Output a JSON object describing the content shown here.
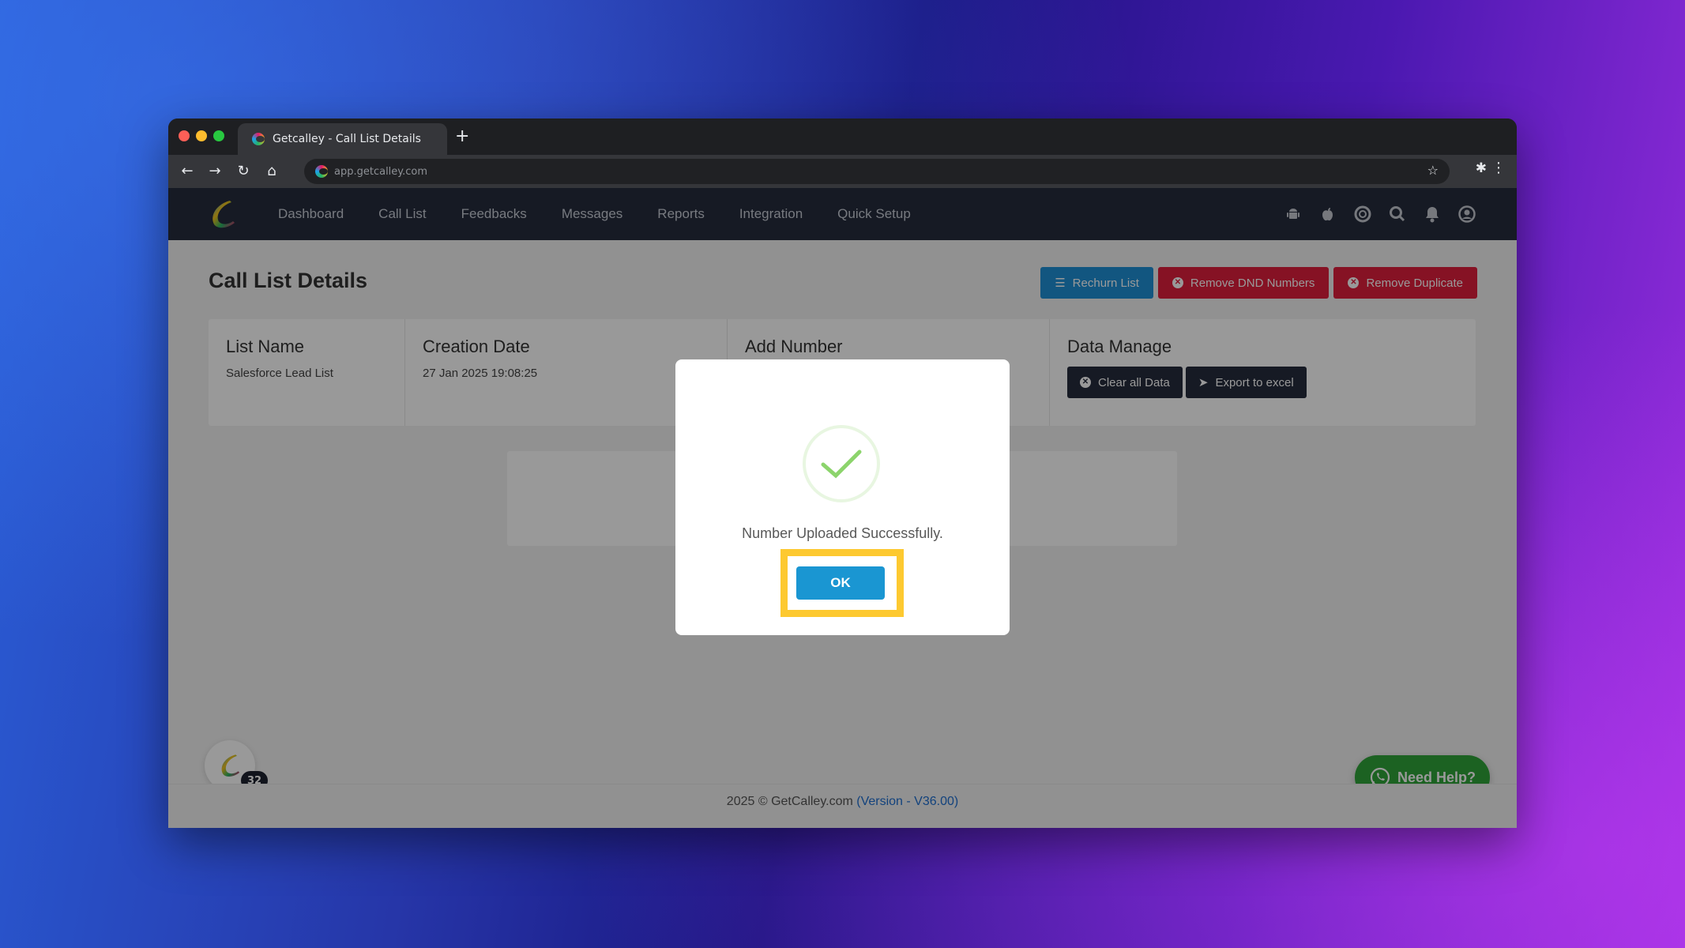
{
  "browser": {
    "tab_title": "Getcalley - Call List Details",
    "new_tab_symbol": "+",
    "url": "app.getcalley.com"
  },
  "nav": {
    "items": [
      {
        "label": "Dashboard"
      },
      {
        "label": "Call List"
      },
      {
        "label": "Feedbacks"
      },
      {
        "label": "Messages"
      },
      {
        "label": "Reports"
      },
      {
        "label": "Integration"
      },
      {
        "label": "Quick Setup"
      }
    ],
    "icons": [
      "android-icon",
      "apple-icon",
      "support-icon",
      "search-icon",
      "bell-icon",
      "user-icon"
    ]
  },
  "page": {
    "title": "Call List Details",
    "actions": {
      "rechurn": "Rechurn List",
      "remove_dnd": "Remove DND Numbers",
      "remove_duplicate": "Remove Duplicate"
    },
    "info": {
      "list_name_label": "List Name",
      "list_name_value": "Salesforce Lead List",
      "creation_date_label": "Creation Date",
      "creation_date_value": "27 Jan 2025 19:08:25",
      "add_number_label": "Add Number",
      "data_manage_label": "Data Manage",
      "clear_all": "Clear all Data",
      "export": "Export to excel"
    }
  },
  "footer": {
    "copyright": "2025 © GetCalley.com ",
    "version": "(Version - V36.00)"
  },
  "chat": {
    "badge_count": "32"
  },
  "help": {
    "label": "Need Help?"
  },
  "modal": {
    "message": "Number Uploaded Successfully.",
    "ok_label": "OK"
  },
  "colors": {
    "accent_blue": "#1f8fd6",
    "danger_red": "#e01e3c",
    "nav_dark": "#262c3c",
    "success_green": "#8cd46c",
    "highlight_yellow": "#fdc930",
    "whatsapp_green": "#2fa33a"
  }
}
